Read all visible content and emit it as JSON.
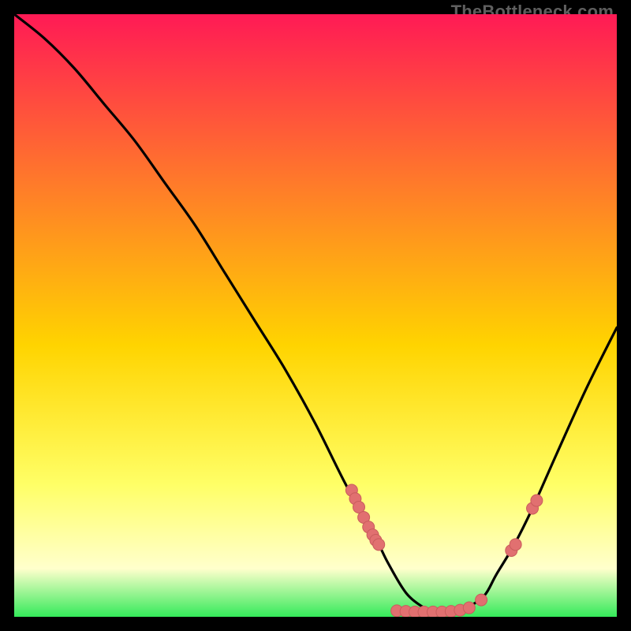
{
  "watermark": "TheBottleneck.com",
  "colors": {
    "background": "#000000",
    "gradient_top": "#ff1a55",
    "gradient_mid_upper": "#ff7a2a",
    "gradient_mid": "#ffd400",
    "gradient_lower": "#ffff66",
    "gradient_pale": "#ffffcc",
    "gradient_bottom": "#34ea5a",
    "curve": "#000000",
    "marker_fill": "#e17070",
    "marker_stroke": "#c95c5c"
  },
  "chart_data": {
    "type": "line",
    "title": "",
    "xlabel": "",
    "ylabel": "",
    "xlim": [
      0,
      100
    ],
    "ylim": [
      0,
      100
    ],
    "grid": false,
    "series": [
      {
        "name": "bottleneck-curve",
        "x": [
          0,
          5,
          10,
          15,
          20,
          25,
          30,
          35,
          40,
          45,
          50,
          55,
          60,
          62,
          65,
          68,
          70,
          72,
          75,
          78,
          80,
          83,
          86,
          90,
          95,
          100
        ],
        "y": [
          100,
          96,
          91,
          85,
          79,
          72,
          65,
          57,
          49,
          41,
          32,
          22,
          13,
          9,
          4,
          1.5,
          0.8,
          0.8,
          1.5,
          3.5,
          7,
          12,
          18,
          27,
          38,
          48
        ]
      }
    ],
    "markers": [
      {
        "x": 56.0,
        "y": 21.0
      },
      {
        "x": 56.6,
        "y": 19.6
      },
      {
        "x": 57.2,
        "y": 18.2
      },
      {
        "x": 58.0,
        "y": 16.5
      },
      {
        "x": 58.8,
        "y": 14.9
      },
      {
        "x": 59.5,
        "y": 13.6
      },
      {
        "x": 60.0,
        "y": 12.7
      },
      {
        "x": 60.5,
        "y": 12.0
      },
      {
        "x": 63.5,
        "y": 1.0
      },
      {
        "x": 65.0,
        "y": 0.9
      },
      {
        "x": 66.5,
        "y": 0.8
      },
      {
        "x": 68.0,
        "y": 0.8
      },
      {
        "x": 69.5,
        "y": 0.8
      },
      {
        "x": 71.0,
        "y": 0.8
      },
      {
        "x": 72.5,
        "y": 0.9
      },
      {
        "x": 74.0,
        "y": 1.1
      },
      {
        "x": 75.5,
        "y": 1.5
      },
      {
        "x": 77.5,
        "y": 2.8
      },
      {
        "x": 82.5,
        "y": 11.0
      },
      {
        "x": 83.2,
        "y": 12.0
      },
      {
        "x": 86.0,
        "y": 18.0
      },
      {
        "x": 86.7,
        "y": 19.3
      }
    ]
  }
}
